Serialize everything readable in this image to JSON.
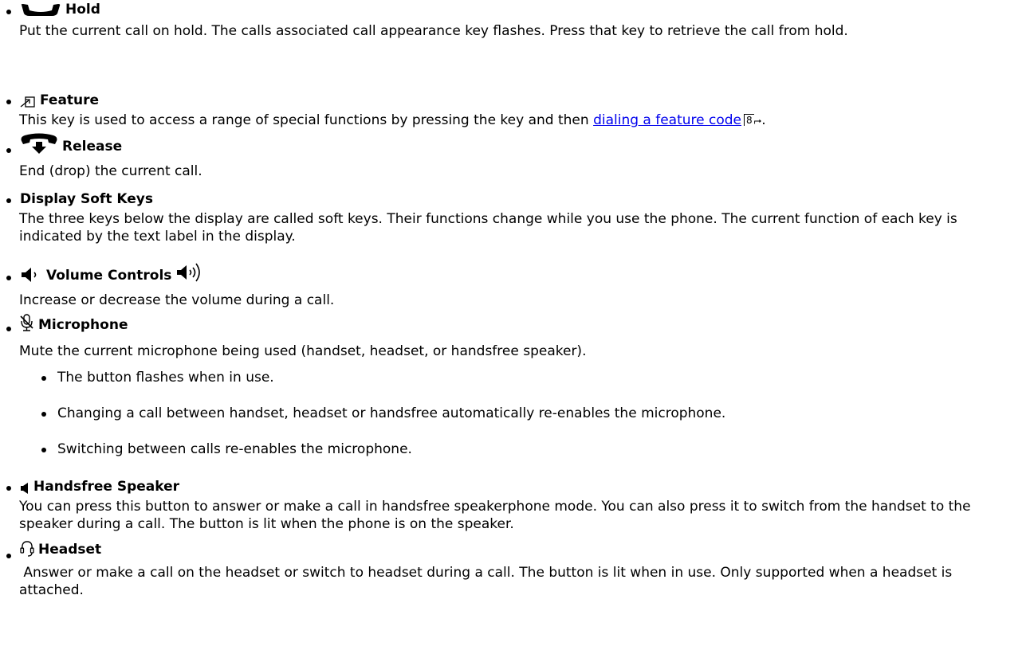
{
  "items": [
    {
      "title": "Hold",
      "icon": "hold-handset-icon",
      "description": "Put the current call on hold. The calls associated call appearance key flashes. Press that key to retrieve the call from hold."
    },
    {
      "title": "Feature",
      "icon": "feature-arrow-icon",
      "description_before": "This key is used to access a range of special functions by pressing the key and then ",
      "link_text": "dialing a feature code",
      "link_ref": "8",
      "description_after": "."
    },
    {
      "title": "Release",
      "icon": "release-handset-icon",
      "description": "End (drop) the current call."
    },
    {
      "title": "Display Soft Keys",
      "description": "The three keys below the display are called soft keys. Their functions change while you use the phone. The current function of each key is indicated by the text label in the display."
    },
    {
      "title": "Volume Controls",
      "icon": "volume-down-icon",
      "icon_after": "volume-up-icon",
      "description": "Increase or decrease the volume during a call."
    },
    {
      "title": "Microphone",
      "icon": "microphone-mute-icon",
      "description": "Mute the current microphone being used (handset, headset, or handsfree speaker).",
      "subitems": [
        "The button flashes when in use.",
        "Changing a call between handset, headset or handsfree automatically re-enables the microphone.",
        "Switching between calls re-enables the microphone."
      ]
    },
    {
      "title": "Handsfree Speaker",
      "icon": "speaker-icon",
      "description": "You can press this button to answer or make a call in handsfree speakerphone mode. You can also press it to switch from the handset to the speaker during a call. The button is lit when the phone is on the speaker."
    },
    {
      "title": "Headset",
      "icon": "headset-icon",
      "description": " Answer or make a call on the headset or switch to headset during a call. The button is lit when in use. Only supported when a headset is attached."
    }
  ]
}
